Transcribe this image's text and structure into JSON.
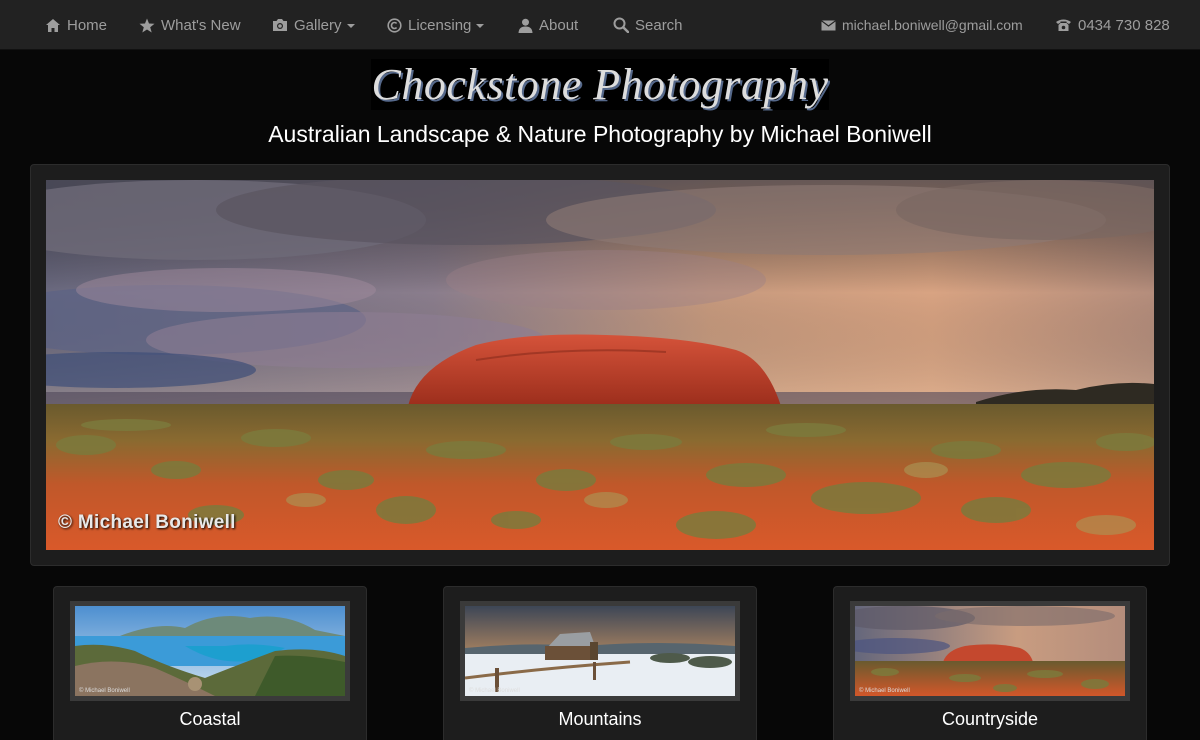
{
  "nav": {
    "home": "Home",
    "whats_new": "What's New",
    "gallery": "Gallery",
    "licensing": "Licensing",
    "about": "About",
    "search": "Search",
    "email": "michael.boniwell@gmail.com",
    "phone": "0434 730 828"
  },
  "header": {
    "brand": "Chockstone Photography",
    "tagline": "Australian Landscape & Nature Photography by Michael Boniwell"
  },
  "hero": {
    "watermark": "© Michael Boniwell"
  },
  "categories": [
    {
      "label": "Coastal",
      "watermark": "© Michael Boniwell"
    },
    {
      "label": "Mountains",
      "watermark": "© Michael Boniwell"
    },
    {
      "label": "Countryside",
      "watermark": "© Michael Boniwell"
    }
  ],
  "colors": {
    "navbar": "#222222",
    "nav_text": "#9d9d9d",
    "page_bg": "#070707",
    "panel_bg": "#1d1d1d",
    "brand_shadow": "#55688a"
  },
  "icons": [
    "home-icon",
    "star-icon",
    "camera-icon",
    "copyright-icon",
    "user-icon",
    "search-icon",
    "envelope-icon",
    "phone-icon"
  ]
}
